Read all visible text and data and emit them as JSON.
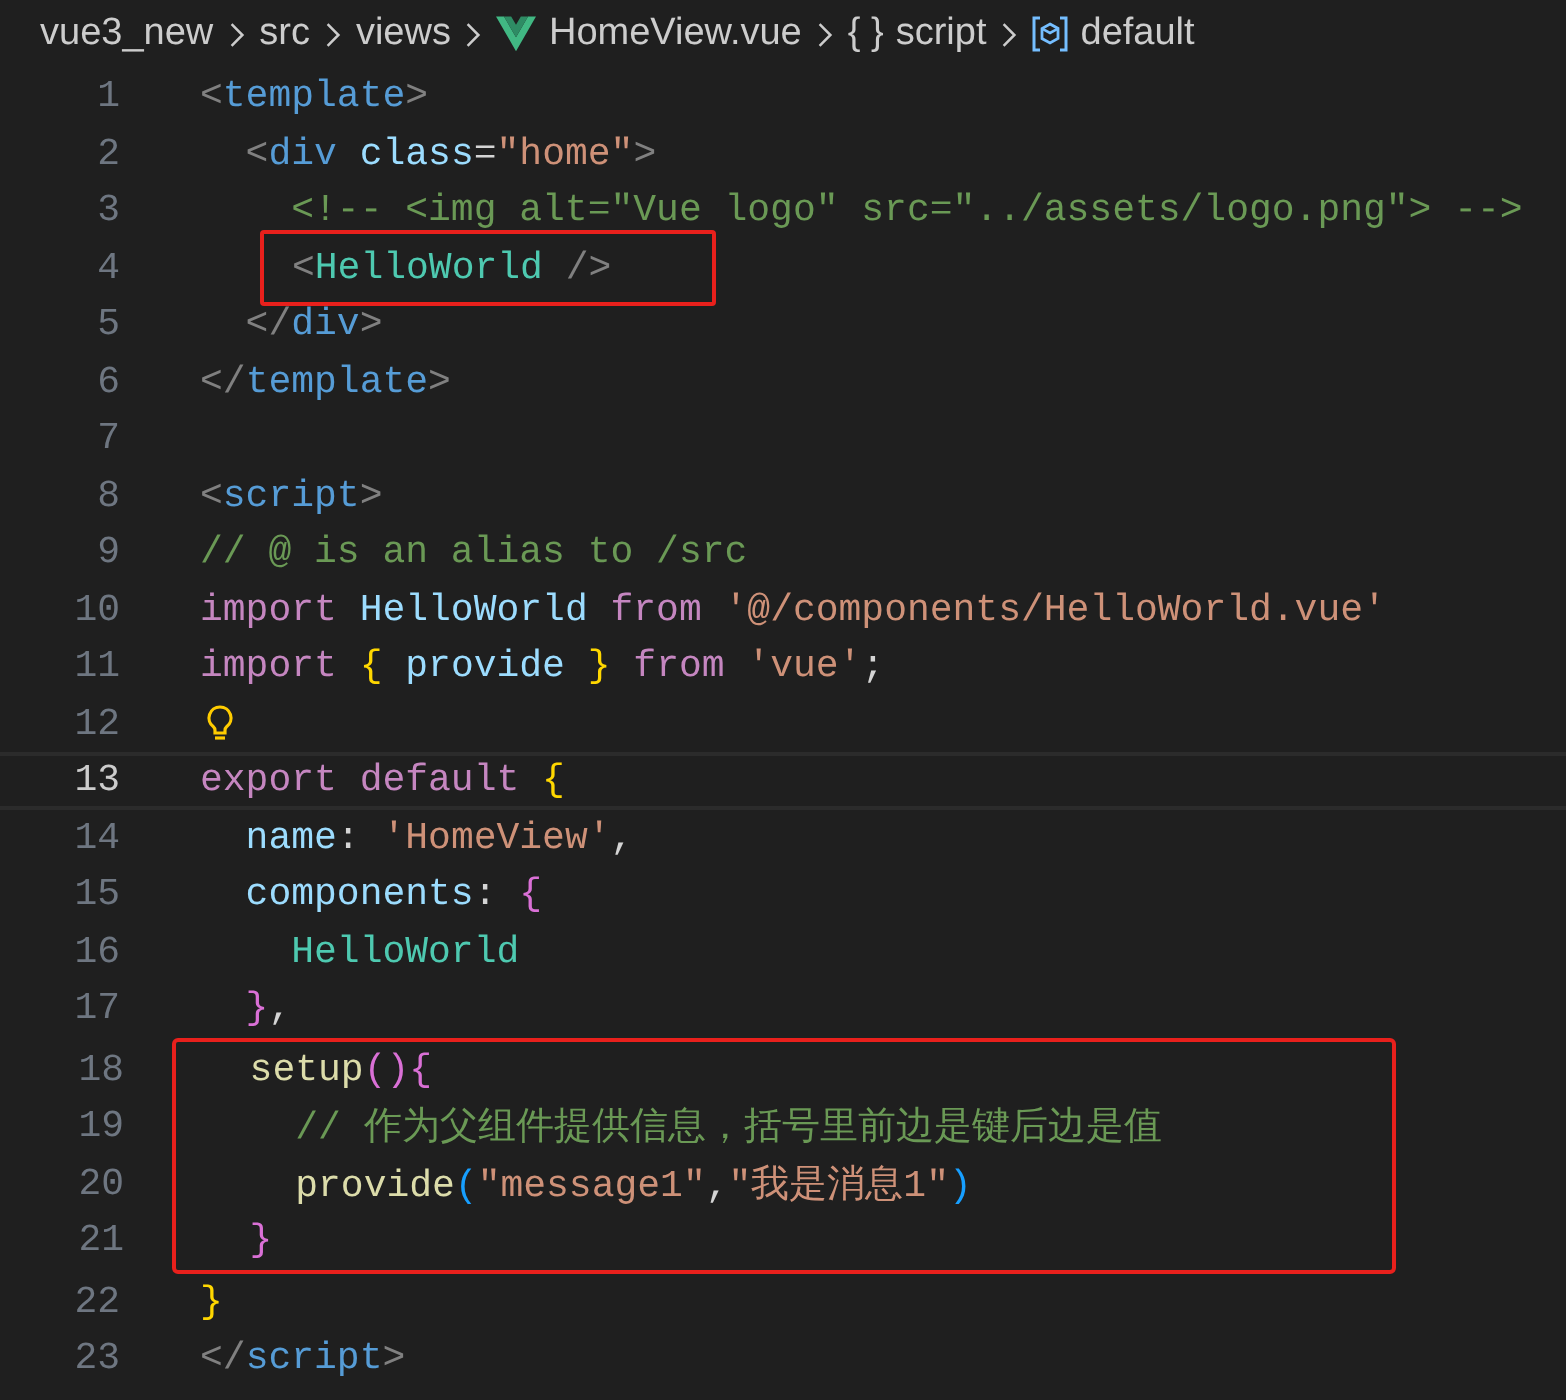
{
  "breadcrumb": [
    {
      "kind": "folder",
      "label": "vue3_new"
    },
    {
      "kind": "folder",
      "label": "src"
    },
    {
      "kind": "folder",
      "label": "views"
    },
    {
      "kind": "vue",
      "label": "HomeView.vue"
    },
    {
      "kind": "braces",
      "glyph": "{ }",
      "label": "script"
    },
    {
      "kind": "symbol",
      "label": "default"
    }
  ],
  "editor": {
    "lines": [
      {
        "number": "1",
        "tokens": [
          {
            "t": "<",
            "kind": "punct"
          },
          {
            "t": "template",
            "kind": "tag"
          },
          {
            "t": ">",
            "kind": "punct"
          }
        ]
      },
      {
        "number": "2",
        "tokens": [
          {
            "t": "  <",
            "kind": "punct"
          },
          {
            "t": "div",
            "kind": "tag"
          },
          {
            "t": " class",
            "kind": "attr"
          },
          {
            "t": "=",
            "kind": "plain"
          },
          {
            "t": "\"home\"",
            "kind": "string"
          },
          {
            "t": ">",
            "kind": "punct"
          }
        ]
      },
      {
        "number": "3",
        "tokens": [
          {
            "t": "    <!-- <img alt=\"Vue logo\" src=\"../assets/logo.png\"> -->",
            "kind": "comment"
          }
        ]
      },
      {
        "number": "4",
        "boxed": true,
        "tokens": [
          {
            "t": "<",
            "kind": "punct"
          },
          {
            "t": "HelloWorld",
            "kind": "component"
          },
          {
            "t": " />",
            "kind": "punct"
          }
        ]
      },
      {
        "number": "5",
        "tokens": [
          {
            "t": "  </",
            "kind": "punct"
          },
          {
            "t": "div",
            "kind": "tag"
          },
          {
            "t": ">",
            "kind": "punct"
          }
        ]
      },
      {
        "number": "6",
        "tokens": [
          {
            "t": "</",
            "kind": "punct"
          },
          {
            "t": "template",
            "kind": "tag"
          },
          {
            "t": ">",
            "kind": "punct"
          }
        ]
      },
      {
        "number": "7"
      },
      {
        "number": "8",
        "tokens": [
          {
            "t": "<",
            "kind": "punct"
          },
          {
            "t": "script",
            "kind": "tag"
          },
          {
            "t": ">",
            "kind": "punct"
          }
        ]
      },
      {
        "number": "9",
        "tokens": [
          {
            "t": "// @ is an alias to /src",
            "kind": "comment"
          }
        ]
      },
      {
        "number": "10",
        "tokens": [
          {
            "t": "import",
            "kind": "keyword"
          },
          {
            "t": " HelloWorld ",
            "kind": "ident"
          },
          {
            "t": "from",
            "kind": "keyword"
          },
          {
            "t": " '@/components/HelloWorld.vue'",
            "kind": "string"
          }
        ]
      },
      {
        "number": "11",
        "tokens": [
          {
            "t": "import",
            "kind": "keyword"
          },
          {
            "t": " {",
            "kind": "brace1"
          },
          {
            "t": " provide ",
            "kind": "ident"
          },
          {
            "t": "}",
            "kind": "brace1"
          },
          {
            "t": " from",
            "kind": "keyword"
          },
          {
            "t": " 'vue'",
            "kind": "string"
          },
          {
            "t": ";",
            "kind": "plain"
          }
        ]
      },
      {
        "number": "12",
        "lightbulb": true
      },
      {
        "number": "13",
        "current": true,
        "tokens": [
          {
            "t": "export default ",
            "kind": "keyword"
          },
          {
            "t": "{",
            "kind": "brace1"
          }
        ]
      },
      {
        "number": "14",
        "tokens": [
          {
            "t": "  name",
            "kind": "ident"
          },
          {
            "t": ": ",
            "kind": "plain"
          },
          {
            "t": "'HomeView'",
            "kind": "string"
          },
          {
            "t": ",",
            "kind": "plain"
          }
        ]
      },
      {
        "number": "15",
        "tokens": [
          {
            "t": "  components",
            "kind": "ident"
          },
          {
            "t": ": ",
            "kind": "plain"
          },
          {
            "t": "{",
            "kind": "brace2"
          }
        ]
      },
      {
        "number": "16",
        "tokens": [
          {
            "t": "    HelloWorld",
            "kind": "component"
          }
        ]
      },
      {
        "number": "17",
        "tokens": [
          {
            "t": "  }",
            "kind": "brace2"
          },
          {
            "t": ",",
            "kind": "plain"
          }
        ]
      },
      {
        "number": "18",
        "boxed": true,
        "tokens": [
          {
            "t": "  setup",
            "kind": "function"
          },
          {
            "t": "()",
            "kind": "brace2"
          },
          {
            "t": "{",
            "kind": "brace2"
          }
        ]
      },
      {
        "number": "19",
        "boxed": true,
        "tokens": [
          {
            "t": "    // 作为父组件提供信息，括号里前边是键后边是值",
            "kind": "comment"
          }
        ]
      },
      {
        "number": "20",
        "boxed": true,
        "tokens": [
          {
            "t": "    provide",
            "kind": "function"
          },
          {
            "t": "(",
            "kind": "brace3"
          },
          {
            "t": "\"message1\"",
            "kind": "string"
          },
          {
            "t": ",",
            "kind": "plain"
          },
          {
            "t": "\"我是消息1\"",
            "kind": "string"
          },
          {
            "t": ")",
            "kind": "brace3"
          }
        ]
      },
      {
        "number": "21",
        "boxed": true,
        "tokens": [
          {
            "t": "  }",
            "kind": "brace2"
          }
        ]
      },
      {
        "number": "22",
        "tokens": [
          {
            "t": "}",
            "kind": "brace1"
          }
        ]
      },
      {
        "number": "23",
        "tokens": [
          {
            "t": "</",
            "kind": "punct"
          },
          {
            "t": "script",
            "kind": "tag"
          },
          {
            "t": ">",
            "kind": "punct"
          }
        ]
      }
    ]
  }
}
